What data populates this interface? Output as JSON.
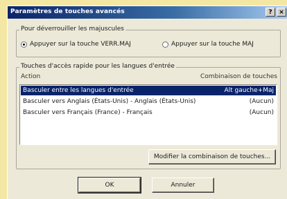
{
  "dialog": {
    "title": "Paramètres de touches avancés",
    "help_button": "?",
    "close_button": "×"
  },
  "caps_group": {
    "label": "Pour déverrouiller les majuscules",
    "options": [
      {
        "label": "Appuyer sur la touche VERR.MAJ",
        "checked": true
      },
      {
        "label": "Appuyer sur la touche MAJ",
        "checked": false
      }
    ]
  },
  "hotkeys_group": {
    "label": "Touches d'accès rapide pour les langues d'entrée",
    "columns": {
      "action": "Action",
      "combination": "Combinaison de touches"
    },
    "rows": [
      {
        "action": "Basculer entre les langues d'entrée",
        "keys": "Alt gauche+Maj",
        "selected": true
      },
      {
        "action": "Basculer vers Anglais (États-Unis) - Anglais (États-Unis)",
        "keys": "(Aucun)",
        "selected": false
      },
      {
        "action": "Basculer vers Français (France) - Français",
        "keys": "(Aucun)",
        "selected": false
      }
    ],
    "modify_button": "Modifier la combinaison de touches..."
  },
  "footer": {
    "ok": "OK",
    "cancel": "Annuler"
  }
}
